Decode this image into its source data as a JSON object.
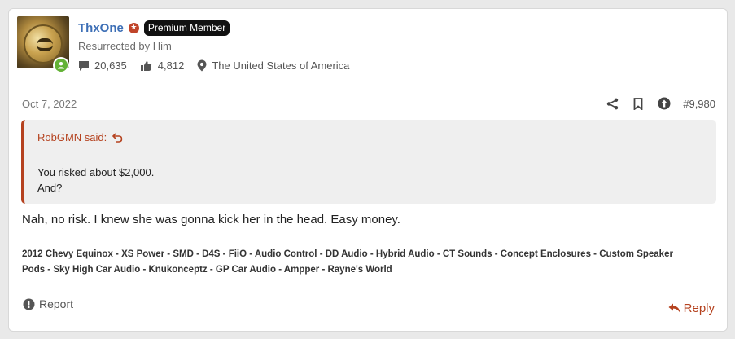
{
  "user": {
    "name": "ThxOne",
    "badge": "Premium Member",
    "title": "Resurrected by Him",
    "messages": "20,635",
    "reactions": "4,812",
    "location": "The United States of America"
  },
  "post": {
    "date": "Oct 7, 2022",
    "number": "#9,980",
    "quote": {
      "author": "RobGMN said:",
      "lines": [
        "You risked about $2,000.",
        "And?"
      ]
    },
    "body": "Nah, no risk. I knew she was gonna kick her in the head. Easy money.",
    "signature": {
      "line1": "2012 Chevy Equinox - XS Power - SMD - D4S - FiiO - Audio Control - DD Audio - Hybrid Audio - CT Sounds - Concept Enclosures - Custom Speaker",
      "line2": "Pods - Sky High Car Audio - Knukonceptz - GP Car Audio - Ampper - Rayne's World"
    },
    "report_label": "Report",
    "reply_label": "Reply"
  },
  "colors": {
    "username": "#3d6fb6",
    "accent": "#b5421f",
    "online": "#63b236"
  },
  "icons": {
    "messages": "speech-bubble-icon",
    "reactions": "thumbs-icon",
    "location": "map-pin-icon",
    "share": "share-icon",
    "bookmark": "bookmark-icon",
    "upvote": "arrow-up-circle-icon",
    "quote_jump": "return-arrow-icon",
    "report": "exclamation-circle-icon",
    "reply": "reply-arrow-icon"
  }
}
